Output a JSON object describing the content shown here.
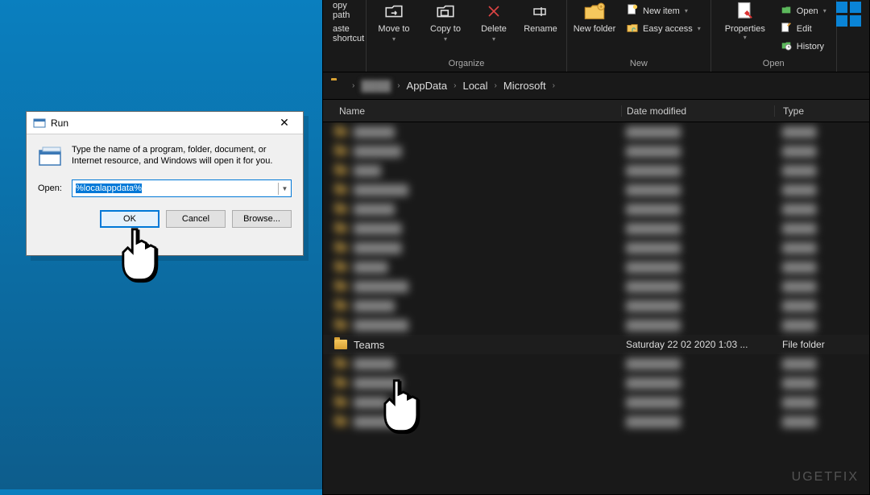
{
  "explorer": {
    "ribbon": {
      "clipboard": {
        "copy_path": "opy path",
        "paste_shortcut": "aste shortcut"
      },
      "organize": {
        "move_to": "Move to",
        "copy_to": "Copy to",
        "delete": "Delete",
        "rename": "Rename",
        "group_label": "Organize"
      },
      "new": {
        "new_folder": "New folder",
        "new_item": "New item",
        "easy_access": "Easy access",
        "group_label": "New"
      },
      "open_group": {
        "properties": "Properties",
        "open": "Open",
        "edit": "Edit",
        "history": "History",
        "group_label": "Open"
      }
    },
    "breadcrumb": {
      "sep": "›",
      "parts": [
        "AppData",
        "Local",
        "Microsoft"
      ]
    },
    "columns": {
      "name": "Name",
      "date": "Date modified",
      "type": "Type"
    },
    "teams_row": {
      "name": "Teams",
      "date": "Saturday 22 02 2020 1:03 ...",
      "type": "File folder"
    }
  },
  "run": {
    "title": "Run",
    "desc": "Type the name of a program, folder, document, or Internet resource, and Windows will open it for you.",
    "open_label": "Open:",
    "value": "%localappdata%",
    "ok": "OK",
    "cancel": "Cancel",
    "browse": "Browse..."
  },
  "watermark": "UGETFIX"
}
